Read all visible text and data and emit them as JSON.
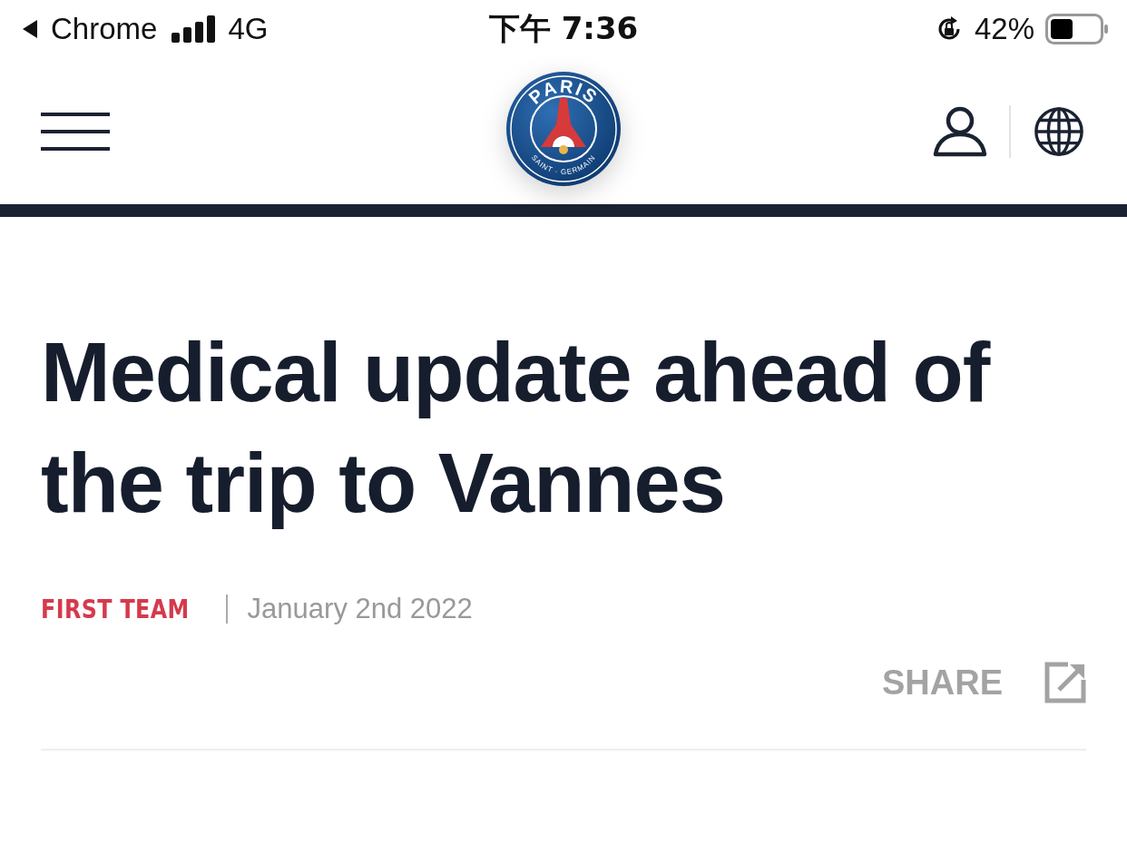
{
  "status_bar": {
    "back_app": "Chrome",
    "network": "4G",
    "time": "下午 7:36",
    "battery": "42%"
  },
  "header": {
    "logo": {
      "top_text": "PARIS",
      "bottom_text": "SAINT · GERMAIN"
    }
  },
  "article": {
    "title": "Medical update ahead of the trip to Vannes",
    "category": "FIRST TEAM",
    "date": "January 2nd 2022",
    "share": "SHARE"
  }
}
